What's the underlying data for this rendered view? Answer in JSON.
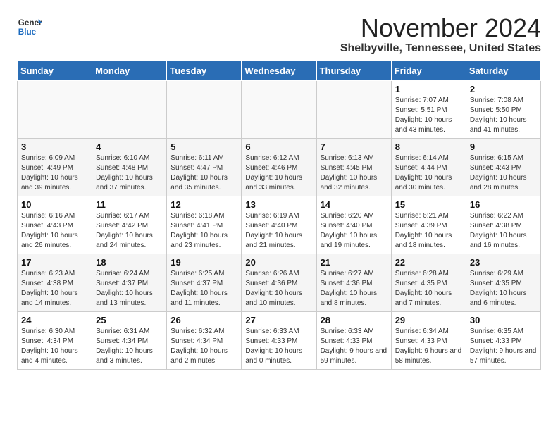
{
  "logo": {
    "line1": "General",
    "line2": "Blue"
  },
  "title": "November 2024",
  "subtitle": "Shelbyville, Tennessee, United States",
  "days_of_week": [
    "Sunday",
    "Monday",
    "Tuesday",
    "Wednesday",
    "Thursday",
    "Friday",
    "Saturday"
  ],
  "weeks": [
    [
      {
        "day": "",
        "info": ""
      },
      {
        "day": "",
        "info": ""
      },
      {
        "day": "",
        "info": ""
      },
      {
        "day": "",
        "info": ""
      },
      {
        "day": "",
        "info": ""
      },
      {
        "day": "1",
        "info": "Sunrise: 7:07 AM\nSunset: 5:51 PM\nDaylight: 10 hours and 43 minutes."
      },
      {
        "day": "2",
        "info": "Sunrise: 7:08 AM\nSunset: 5:50 PM\nDaylight: 10 hours and 41 minutes."
      }
    ],
    [
      {
        "day": "3",
        "info": "Sunrise: 6:09 AM\nSunset: 4:49 PM\nDaylight: 10 hours and 39 minutes."
      },
      {
        "day": "4",
        "info": "Sunrise: 6:10 AM\nSunset: 4:48 PM\nDaylight: 10 hours and 37 minutes."
      },
      {
        "day": "5",
        "info": "Sunrise: 6:11 AM\nSunset: 4:47 PM\nDaylight: 10 hours and 35 minutes."
      },
      {
        "day": "6",
        "info": "Sunrise: 6:12 AM\nSunset: 4:46 PM\nDaylight: 10 hours and 33 minutes."
      },
      {
        "day": "7",
        "info": "Sunrise: 6:13 AM\nSunset: 4:45 PM\nDaylight: 10 hours and 32 minutes."
      },
      {
        "day": "8",
        "info": "Sunrise: 6:14 AM\nSunset: 4:44 PM\nDaylight: 10 hours and 30 minutes."
      },
      {
        "day": "9",
        "info": "Sunrise: 6:15 AM\nSunset: 4:43 PM\nDaylight: 10 hours and 28 minutes."
      }
    ],
    [
      {
        "day": "10",
        "info": "Sunrise: 6:16 AM\nSunset: 4:43 PM\nDaylight: 10 hours and 26 minutes."
      },
      {
        "day": "11",
        "info": "Sunrise: 6:17 AM\nSunset: 4:42 PM\nDaylight: 10 hours and 24 minutes."
      },
      {
        "day": "12",
        "info": "Sunrise: 6:18 AM\nSunset: 4:41 PM\nDaylight: 10 hours and 23 minutes."
      },
      {
        "day": "13",
        "info": "Sunrise: 6:19 AM\nSunset: 4:40 PM\nDaylight: 10 hours and 21 minutes."
      },
      {
        "day": "14",
        "info": "Sunrise: 6:20 AM\nSunset: 4:40 PM\nDaylight: 10 hours and 19 minutes."
      },
      {
        "day": "15",
        "info": "Sunrise: 6:21 AM\nSunset: 4:39 PM\nDaylight: 10 hours and 18 minutes."
      },
      {
        "day": "16",
        "info": "Sunrise: 6:22 AM\nSunset: 4:38 PM\nDaylight: 10 hours and 16 minutes."
      }
    ],
    [
      {
        "day": "17",
        "info": "Sunrise: 6:23 AM\nSunset: 4:38 PM\nDaylight: 10 hours and 14 minutes."
      },
      {
        "day": "18",
        "info": "Sunrise: 6:24 AM\nSunset: 4:37 PM\nDaylight: 10 hours and 13 minutes."
      },
      {
        "day": "19",
        "info": "Sunrise: 6:25 AM\nSunset: 4:37 PM\nDaylight: 10 hours and 11 minutes."
      },
      {
        "day": "20",
        "info": "Sunrise: 6:26 AM\nSunset: 4:36 PM\nDaylight: 10 hours and 10 minutes."
      },
      {
        "day": "21",
        "info": "Sunrise: 6:27 AM\nSunset: 4:36 PM\nDaylight: 10 hours and 8 minutes."
      },
      {
        "day": "22",
        "info": "Sunrise: 6:28 AM\nSunset: 4:35 PM\nDaylight: 10 hours and 7 minutes."
      },
      {
        "day": "23",
        "info": "Sunrise: 6:29 AM\nSunset: 4:35 PM\nDaylight: 10 hours and 6 minutes."
      }
    ],
    [
      {
        "day": "24",
        "info": "Sunrise: 6:30 AM\nSunset: 4:34 PM\nDaylight: 10 hours and 4 minutes."
      },
      {
        "day": "25",
        "info": "Sunrise: 6:31 AM\nSunset: 4:34 PM\nDaylight: 10 hours and 3 minutes."
      },
      {
        "day": "26",
        "info": "Sunrise: 6:32 AM\nSunset: 4:34 PM\nDaylight: 10 hours and 2 minutes."
      },
      {
        "day": "27",
        "info": "Sunrise: 6:33 AM\nSunset: 4:33 PM\nDaylight: 10 hours and 0 minutes."
      },
      {
        "day": "28",
        "info": "Sunrise: 6:33 AM\nSunset: 4:33 PM\nDaylight: 9 hours and 59 minutes."
      },
      {
        "day": "29",
        "info": "Sunrise: 6:34 AM\nSunset: 4:33 PM\nDaylight: 9 hours and 58 minutes."
      },
      {
        "day": "30",
        "info": "Sunrise: 6:35 AM\nSunset: 4:33 PM\nDaylight: 9 hours and 57 minutes."
      }
    ]
  ]
}
